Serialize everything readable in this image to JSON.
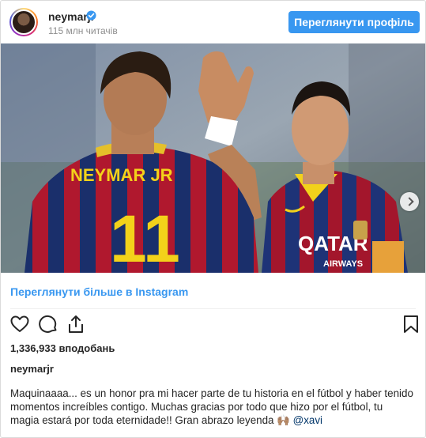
{
  "header": {
    "username": "neymarjr",
    "followers": "115 млн читачів",
    "profile_button": "Переглянути профіль"
  },
  "link": {
    "view_more": "Переглянути більше в Instagram"
  },
  "photo": {
    "jersey_name": "NEYMAR JR",
    "jersey_number": "11",
    "sponsor": "QATAR",
    "sponsor_sub": "AIRWAYS"
  },
  "post": {
    "likes": "1,336,933 вподобань",
    "username": "neymarjr",
    "caption_text": "Maquinaaaa... es un honor pra mi hacer parte de tu historia en el fútbol y haber tenido momentos increíbles contigo. Muchas gracias por todo que hizo por el fútbol, tu magia estará por toda eternidade!! Gran abrazo leyenda 🙌🏽 ",
    "mention": "@xavi"
  },
  "icons": {
    "verified": "verified-badge-icon",
    "like": "heart-icon",
    "comment": "comment-icon",
    "share": "share-icon",
    "save": "bookmark-icon",
    "next": "chevron-right-icon"
  },
  "colors": {
    "accent": "#3897f0",
    "text": "#262626",
    "muted": "#8e8e8e",
    "mention": "#003569"
  }
}
